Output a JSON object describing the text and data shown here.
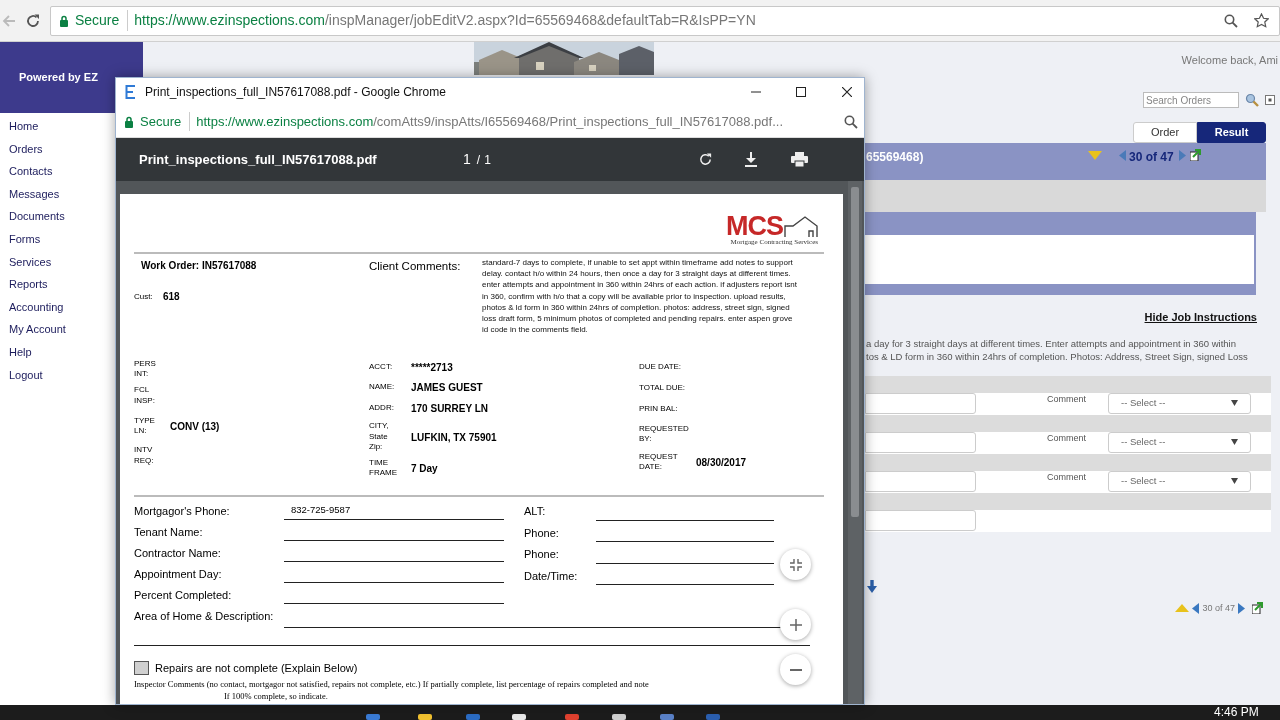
{
  "browser": {
    "secure": "Secure",
    "url_host": "https://www.ezinspections.com",
    "url_path": "/inspManager/jobEditV2.aspx?Id=65569468&defaultTab=R&IsPP=YN"
  },
  "sidebar": {
    "brand": "Powered by EZ",
    "items": [
      "Home",
      "Orders",
      "Contacts",
      "Messages",
      "Documents",
      "Forms",
      "Services",
      "Reports",
      "Accounting",
      "My Account",
      "Help",
      "Logout"
    ]
  },
  "header": {
    "welcome": "Welcome back, Ami",
    "search_placeholder": "Search Orders"
  },
  "tabs": [
    {
      "label": "Order",
      "selected": false
    },
    {
      "label": "Result",
      "selected": true
    }
  ],
  "job_bar": {
    "id_fragment": "65569468)",
    "pager": "30 of 47"
  },
  "instructions": {
    "toggle": "Hide Job Instructions",
    "lines": [
      "a day for 3 straight days at different times. Enter attempts and appointment in 360 within",
      "tos & LD form in 360 within 24hrs of completion. Photos: Address, Street Sign, signed Loss"
    ]
  },
  "result_rows": [
    {
      "kind": "comment",
      "comment_label": "Comment",
      "select": "-- Select --"
    },
    {
      "kind": "comment",
      "comment_label": "Comment",
      "select": "-- Select --"
    },
    {
      "kind": "comment",
      "comment_label": "Comment",
      "select": "-- Select --"
    },
    {
      "kind": "plain"
    }
  ],
  "bottom_pager": "30 of 47",
  "popup": {
    "title": "Print_inspections_full_IN57617088.pdf - Google Chrome",
    "secure": "Secure",
    "url_host": "https://www.ezinspections.com",
    "url_path": "/comAtts9/inspAtts/I65569468/Print_inspections_full_IN57617088.pdf...",
    "pdf": {
      "file_name": "Print_inspections_full_IN57617088.pdf",
      "page_current": "1",
      "page_separator": "/",
      "page_total": "1",
      "logo": {
        "mark": "MCS",
        "tagline": "Mortgage Contracting Services"
      },
      "work_order": "Work Order: IN57617088",
      "cust_label": "Cust:",
      "cust_value": "618",
      "client_comments_label": "Client Comments:",
      "client_comments": "standard-7 days to complete, if unable to set appt within timeframe add notes to support delay. contact h/o within 24 hours, then once a day for 3 straight days at different times. enter attempts and appointment in 360 within 24hrs of each action. if adjusters report isnt in 360, confirm with h/o that a copy will be available prior to inspection. upload results, photos & ld form in 360 within 24hrs of completion. photos: address, street sign, signed loss draft form, 5 minimum photos of completed and pending repairs. enter aspen grove id code in the comments field.",
      "info_left": [
        {
          "label": "PERS INT:"
        },
        {
          "label": "FCL INSP:"
        },
        {
          "label": "TYPE LN:",
          "value": "CONV (13)"
        },
        {
          "label": "INTV REQ:"
        }
      ],
      "info_middle": [
        {
          "label": "ACCT:",
          "value": "*****2713"
        },
        {
          "label": "NAME:",
          "value": "JAMES GUEST"
        },
        {
          "label": "ADDR:",
          "value": "170 SURREY LN"
        },
        {
          "label": "CITY, State Zip:",
          "value": "LUFKIN, TX 75901"
        },
        {
          "label": "TIME FRAME",
          "value": "7 Day"
        }
      ],
      "info_right": [
        {
          "label": "DUE DATE:"
        },
        {
          "label": "TOTAL DUE:"
        },
        {
          "label": "PRIN BAL:"
        },
        {
          "label": "REQUESTED BY:"
        },
        {
          "label": "REQUEST DATE:",
          "value": "08/30/2017"
        }
      ],
      "form_left": [
        {
          "label": "Mortgagor's Phone:",
          "value": "832-725-9587"
        },
        {
          "label": "Tenant Name:"
        },
        {
          "label": "Contractor Name:"
        },
        {
          "label": "Appointment Day:"
        },
        {
          "label": "Percent Completed:"
        }
      ],
      "form_right": [
        {
          "label": "ALT:"
        },
        {
          "label": "Phone:"
        },
        {
          "label": "Phone:"
        },
        {
          "label": "Date/Time:"
        }
      ],
      "area_label": "Area of Home & Description:",
      "repairs_checkbox": {
        "label": "Repairs are not complete (Explain Below)",
        "checked": false
      },
      "inspector_comments": [
        "Inspector Comments (no contact, mortgagor not satisfied, repairs not complete, etc.) If partially complete, list percentage of repairs completed and note",
        "If 100% complete, so indicate."
      ]
    }
  },
  "taskbar": {
    "time": "4:46 PM"
  }
}
